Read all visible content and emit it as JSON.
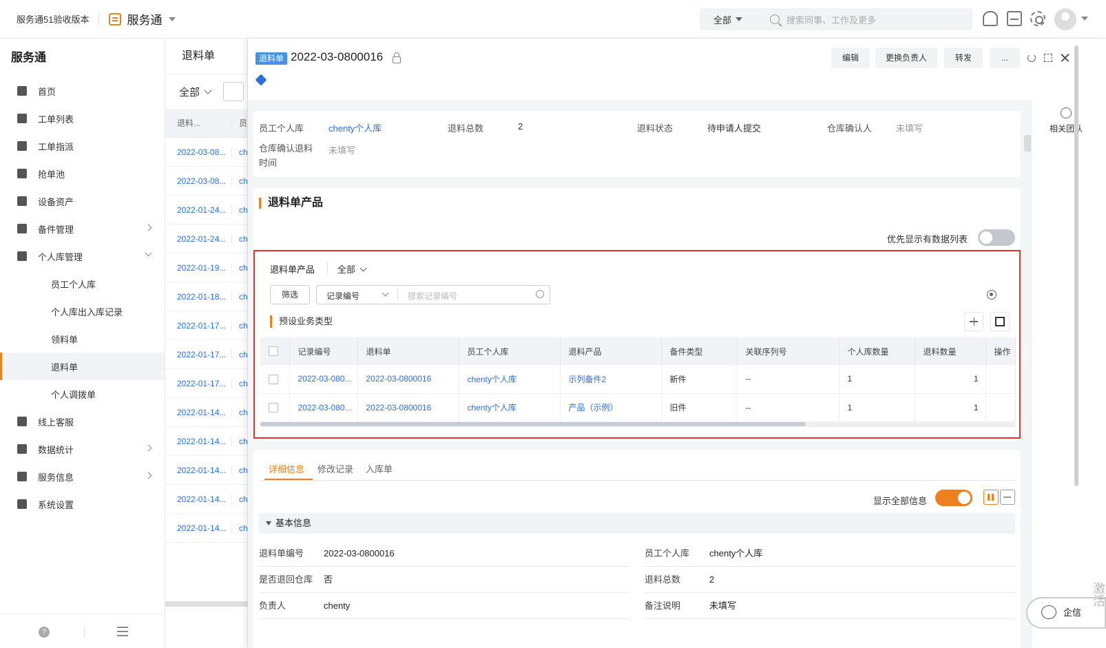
{
  "topbar": {
    "version": "服务通51验收版本",
    "app_name": "服务通",
    "search_scope": "全部",
    "search_placeholder": "搜索同事、工作及更多"
  },
  "sidebar": {
    "title": "服务通",
    "items": [
      {
        "label": "首页",
        "icon": "home-icon"
      },
      {
        "label": "工单列表",
        "icon": "list-icon"
      },
      {
        "label": "工单指派",
        "icon": "assign-icon"
      },
      {
        "label": "抢单池",
        "icon": "pool-icon"
      },
      {
        "label": "设备资产",
        "icon": "device-icon"
      },
      {
        "label": "备件管理",
        "icon": "parts-icon"
      },
      {
        "label": "个人库管理",
        "icon": "personal-store-icon"
      },
      {
        "label": "员工个人库"
      },
      {
        "label": "个人库出入库记录"
      },
      {
        "label": "领料单"
      },
      {
        "label": "退料单"
      },
      {
        "label": "个人调拨单"
      },
      {
        "label": "线上客服",
        "icon": "service-icon"
      },
      {
        "label": "数据统计",
        "icon": "chart-icon"
      },
      {
        "label": "服务信息",
        "icon": "info-icon"
      },
      {
        "label": "系统设置",
        "icon": "settings-icon"
      }
    ],
    "help": "?"
  },
  "list": {
    "title": "退料单",
    "filter": "全部",
    "header": "退料...",
    "header2": "员",
    "rows": [
      "2022-03-08...",
      "2022-03-08...",
      "2022-01-24...",
      "2022-01-24...",
      "2022-01-19...",
      "2022-01-18...",
      "2022-01-17...",
      "2022-01-17...",
      "2022-01-17...",
      "2022-01-14...",
      "2022-01-14...",
      "2022-01-14...",
      "2022-01-14...",
      "2022-01-14..."
    ],
    "row_col2": "ch"
  },
  "detail": {
    "tag": "退料单",
    "title": "2022-03-0800016",
    "buttons": {
      "edit": "编辑",
      "change_owner": "更换负责人",
      "forward": "转发",
      "more": "..."
    },
    "related_team": "相关团队",
    "info": {
      "store_label": "员工个人库",
      "store_value": "chenty个人库",
      "total_label": "退料总数",
      "total_value": "2",
      "status_label": "退料状态",
      "status_value": "待申请人提交",
      "confirmer_label": "仓库确认人",
      "confirmer_value": "未填写",
      "confirm_time_label_1": "仓库确认退料",
      "confirm_time_label_2": "时间",
      "confirm_time_value": "未填写"
    },
    "products": {
      "section_title": "退料单产品",
      "prefer_label": "优先显示有数据列表",
      "subtab": "退料单产品",
      "subtab_filter": "全部",
      "filter_btn": "筛选",
      "select_value": "记录编号",
      "search_placeholder": "搜索记录编号",
      "biz_type": "预设业务类型",
      "columns": [
        "记录编号",
        "退料单",
        "员工个人库",
        "退料产品",
        "备件类型",
        "关联序列号",
        "个人库数量",
        "退料数量",
        "操作"
      ],
      "rows": [
        {
          "record": "2022-03-080...",
          "order": "2022-03-0800016",
          "store": "chenty个人库",
          "product": "示列备件2",
          "type": "新件",
          "serial": "--",
          "store_qty": "1",
          "return_qty": "1"
        },
        {
          "record": "2022-03-080...",
          "order": "2022-03-0800016",
          "store": "chenty个人库",
          "product": "产品（示例）",
          "type": "旧件",
          "serial": "--",
          "store_qty": "1",
          "return_qty": "1"
        }
      ]
    },
    "tabs": [
      "详细信息",
      "修改记录",
      "入库单"
    ],
    "show_all_label": "显示全部信息",
    "basic_title": "基本信息",
    "fields_left": [
      {
        "k": "退料单编号",
        "v": "2022-03-0800016"
      },
      {
        "k": "是否退回仓库",
        "v": "否"
      },
      {
        "k": "负责人",
        "v": "chenty"
      }
    ],
    "fields_right": [
      {
        "k": "员工个人库",
        "v": "chenty个人库"
      },
      {
        "k": "退料总数",
        "v": "2"
      },
      {
        "k": "备注说明",
        "v": "未填写"
      }
    ]
  },
  "chat": {
    "label": "企信"
  },
  "watermark": "激活"
}
